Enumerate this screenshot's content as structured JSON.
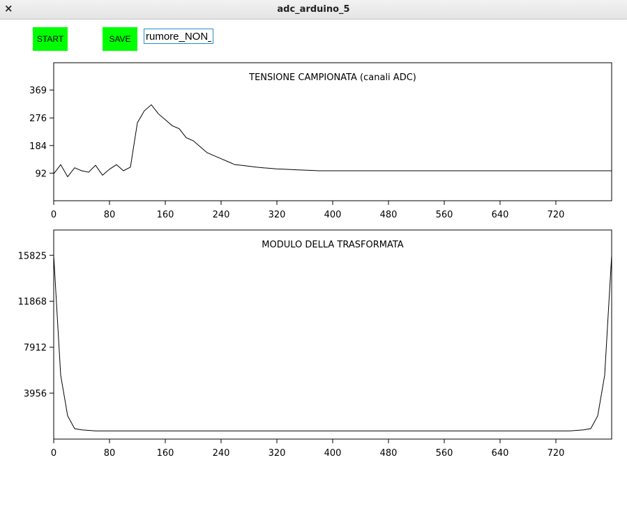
{
  "window": {
    "title": "adc_arduino_5",
    "close_glyph": "×"
  },
  "toolbar": {
    "start_label": "START",
    "save_label": "SAVE",
    "filename_value": "rumore_NON_",
    "button_color": "#00ff00"
  },
  "chart_data": [
    {
      "type": "line",
      "title": "TENSIONE CAMPIONATA (canali ADC)",
      "x_ticks": [
        "0",
        "80",
        "160",
        "240",
        "320",
        "400",
        "480",
        "560",
        "640",
        "720"
      ],
      "y_ticks": [
        "92",
        "184",
        "276",
        "369"
      ],
      "xlim": [
        0,
        800
      ],
      "ylim": [
        0,
        460
      ],
      "series": [
        {
          "x_start": 0,
          "x_step": 10,
          "y": [
            90,
            120,
            80,
            110,
            100,
            95,
            118,
            85,
            105,
            120,
            100,
            112,
            260,
            300,
            320,
            290,
            270,
            250,
            240,
            210,
            200,
            180,
            160,
            150,
            140,
            130,
            120,
            118,
            115,
            112,
            110,
            108,
            106,
            105,
            104,
            103,
            102,
            101,
            100,
            100,
            100,
            100,
            100,
            100,
            100,
            100,
            100,
            100,
            100,
            100,
            100,
            100,
            100,
            100,
            100,
            100,
            100,
            100,
            100,
            100,
            100,
            100,
            100,
            100,
            100,
            100,
            100,
            100,
            100,
            100,
            100,
            100,
            100,
            100,
            100,
            100,
            100,
            100,
            100,
            100,
            100
          ]
        }
      ]
    },
    {
      "type": "line",
      "title": "MODULO DELLA TRASFORMATA",
      "x_ticks": [
        "0",
        "80",
        "160",
        "240",
        "320",
        "400",
        "480",
        "560",
        "640",
        "720"
      ],
      "y_ticks": [
        "3956",
        "7912",
        "11868",
        "15825"
      ],
      "xlim": [
        0,
        800
      ],
      "ylim": [
        0,
        18000
      ],
      "series": [
        {
          "x_start": 0,
          "x_step": 10,
          "y": [
            15825,
            5500,
            2000,
            900,
            800,
            750,
            700,
            700,
            700,
            700,
            700,
            700,
            700,
            700,
            700,
            700,
            700,
            700,
            700,
            700,
            700,
            700,
            700,
            700,
            700,
            700,
            700,
            700,
            700,
            700,
            700,
            700,
            700,
            700,
            700,
            700,
            700,
            700,
            700,
            700,
            700,
            700,
            700,
            700,
            700,
            700,
            700,
            700,
            700,
            700,
            700,
            700,
            700,
            700,
            700,
            700,
            700,
            700,
            700,
            700,
            700,
            700,
            700,
            700,
            700,
            700,
            700,
            700,
            700,
            700,
            700,
            700,
            700,
            700,
            700,
            750,
            800,
            900,
            2000,
            5500,
            15825
          ]
        }
      ]
    }
  ]
}
